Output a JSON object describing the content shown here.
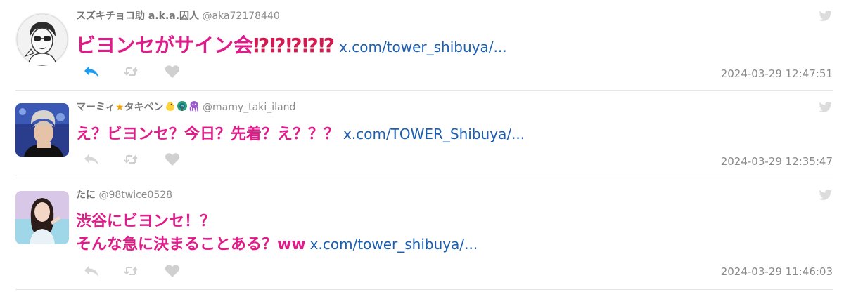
{
  "tweets": [
    {
      "name": "スズキチョコ助 a.k.a.囚人",
      "handle": "@aka72178440",
      "text": "ビヨンセがサイン会",
      "exclaims": "⁉⁉⁉⁉⁉",
      "link": "x.com/tower_shibuya/...",
      "timestamp": "2024-03-29 12:47:51",
      "reply_active": true
    },
    {
      "name": "マーミィ",
      "name_star": "★",
      "name_rest": "タキペン",
      "name_emoji": [
        "chick-icon",
        "peacock-icon",
        "octopus-icon"
      ],
      "handle": "@mamy_taki_iland",
      "text": "え？ビヨンセ？今日？先着？え？？？",
      "link": "x.com/TOWER_Shibuya/...",
      "timestamp": "2024-03-29 12:35:47",
      "reply_active": false
    },
    {
      "name": "たに",
      "handle": "@98twice0528",
      "text_line1": "渋谷にビヨンセ！？",
      "text_line2": "そんな急に決まることある？ww",
      "link": "x.com/tower_shibuya/...",
      "timestamp": "2024-03-29 11:46:03",
      "reply_active": false
    }
  ],
  "colors": {
    "text_pink": "#e01c8a",
    "link_blue": "#1a5fb4",
    "reply_active_blue": "#1d9bf0",
    "icon_grey": "#d0d0d0"
  }
}
